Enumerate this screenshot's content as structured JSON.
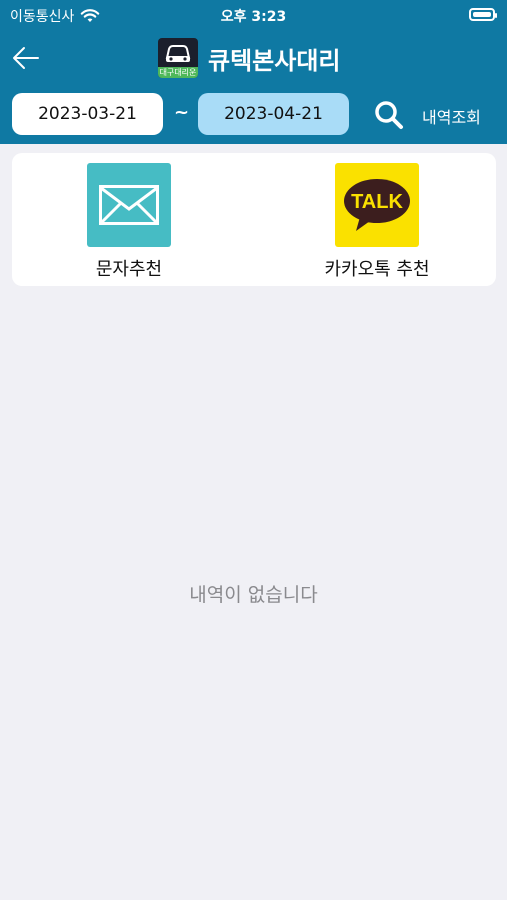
{
  "status_bar": {
    "carrier": "이동통신사",
    "time": "오후 3:23"
  },
  "nav": {
    "title": "큐텍본사대리",
    "logo_text": "대구대리운전"
  },
  "date_filter": {
    "from": "2023-03-21",
    "separator": "~",
    "to": "2023-04-21",
    "search_label": "내역조회"
  },
  "share": {
    "sms_label": "문자추천",
    "kakao_label": "카카오톡 추천",
    "kakao_icon_text": "TALK"
  },
  "empty_message": "내역이 없습니다",
  "colors": {
    "header": "#0f79a3",
    "date_to_bg": "#a9dcf7",
    "sms": "#46bcc4",
    "kakao": "#fae100"
  }
}
